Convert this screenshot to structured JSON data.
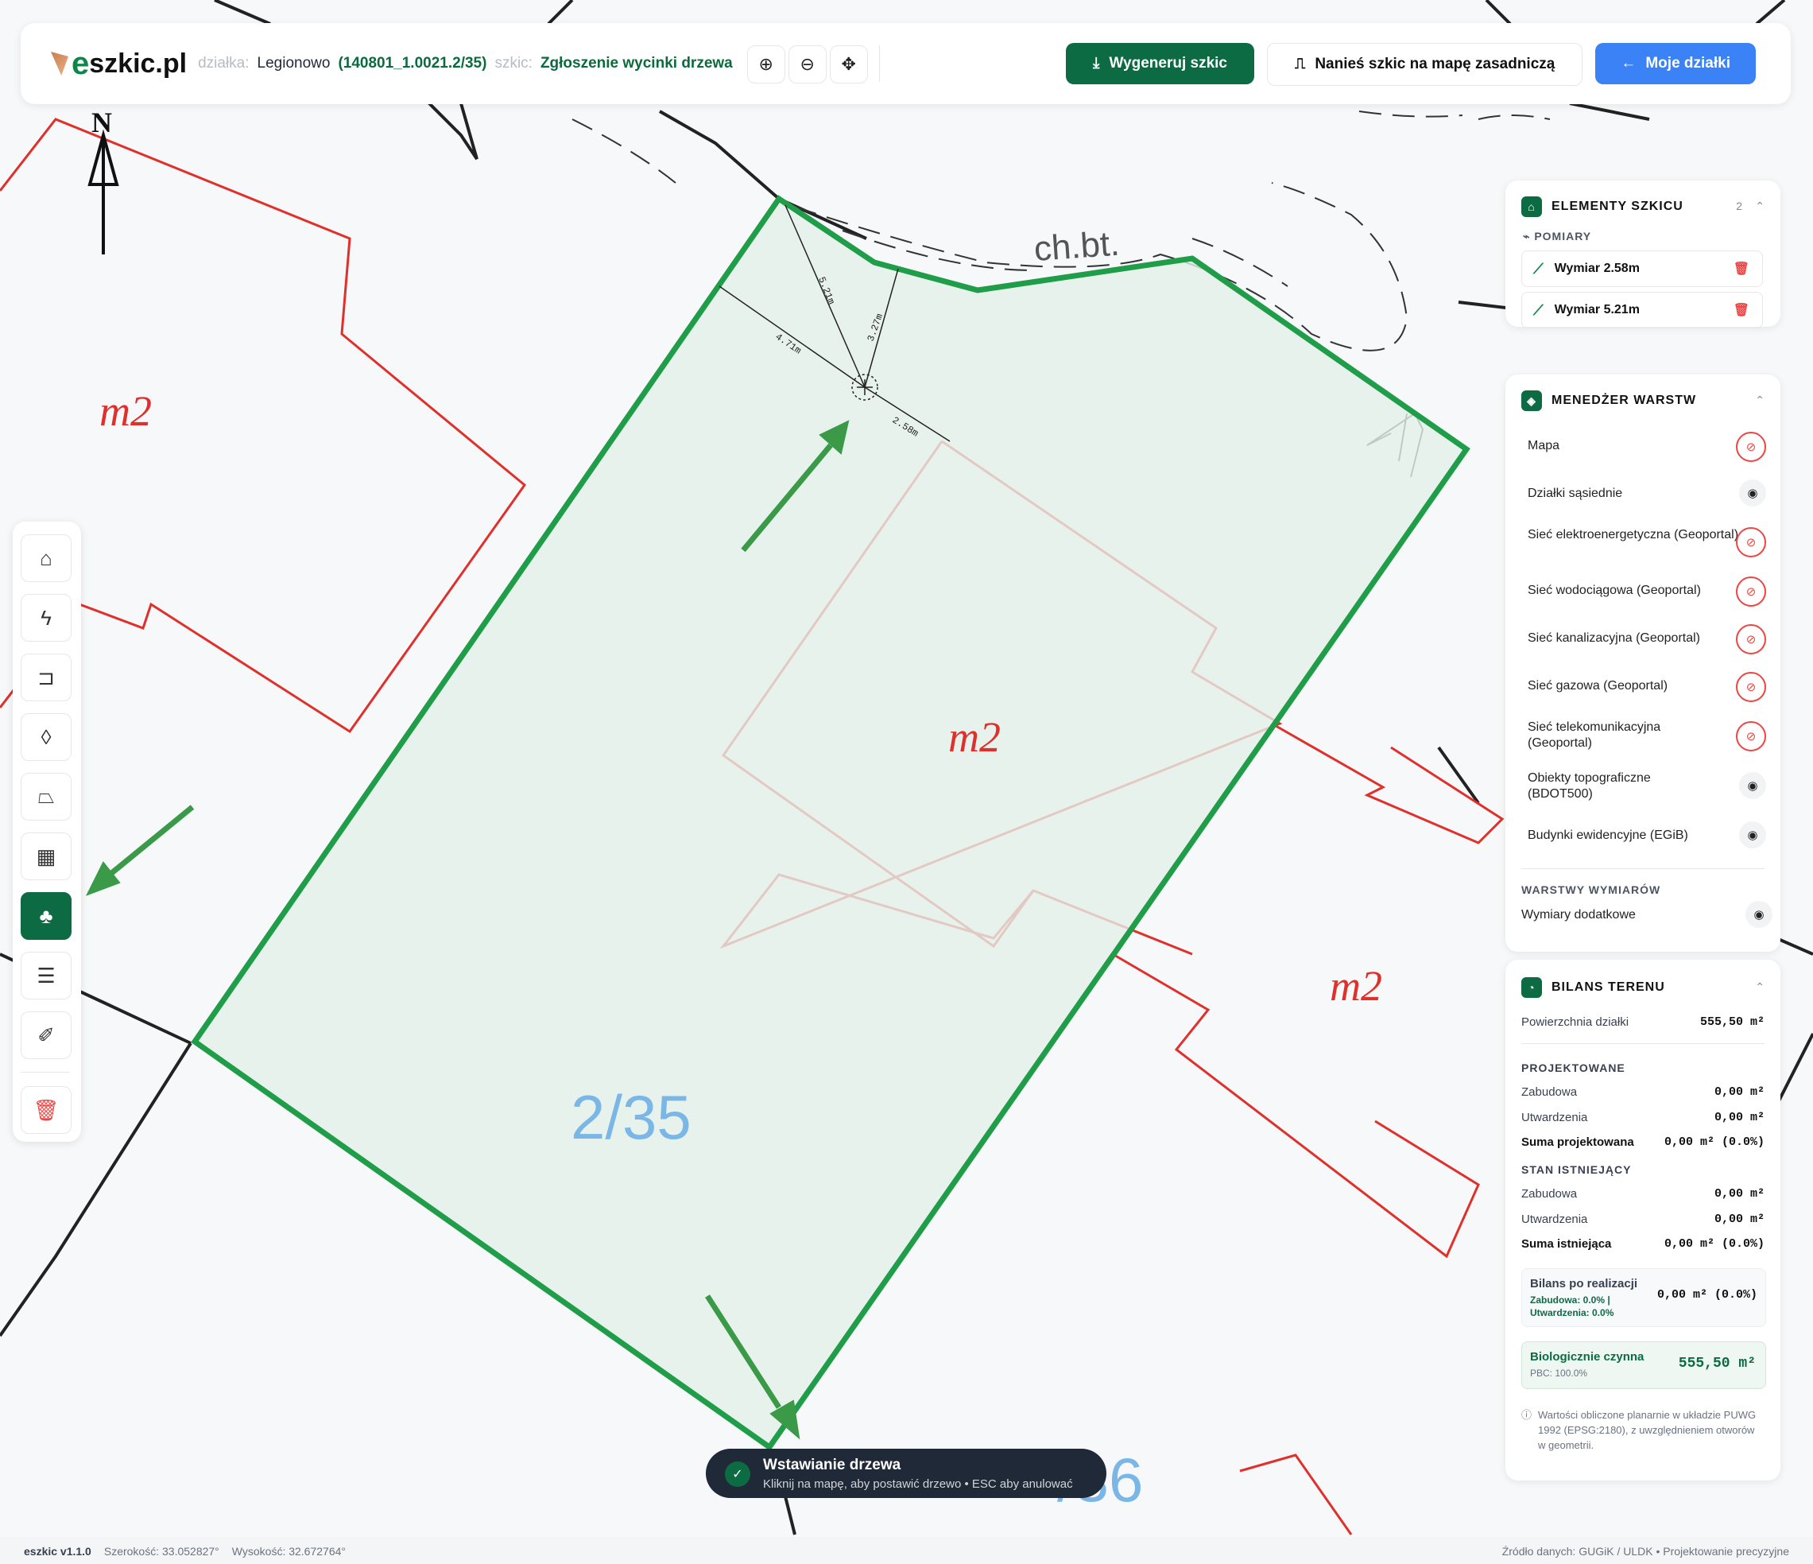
{
  "header": {
    "logo_text": "szkic.pl",
    "logo_letter": "e",
    "plot_label": "działka:",
    "plot_city": "Legionowo",
    "plot_id": "(140801_1.0021.2/35)",
    "sketch_label": "szkic:",
    "sketch_name": "Zgłoszenie wycinki drzewa",
    "buttons": {
      "generate": "Wygeneruj szkic",
      "overlay": "Nanieś szkic na mapę zasadniczą",
      "my_plots": "Moje działki"
    }
  },
  "map": {
    "north": "N",
    "plot_number": "2/35",
    "plot_number_2": "/36",
    "building_labels": [
      "m2",
      "m2",
      "m2"
    ],
    "road_label": "ch.bt.",
    "measurements": [
      "5.21m",
      "4.71m",
      "3.27m",
      "2.58m"
    ]
  },
  "sketch_elements": {
    "title": "ELEMENTY SZKICU",
    "count": "2",
    "section": "POMIARY",
    "items": [
      "Wymiar 2.58m",
      "Wymiar 5.21m"
    ]
  },
  "layers": {
    "title": "MENEDŻER WARSTW",
    "items": [
      {
        "label": "Mapa",
        "visible": false
      },
      {
        "label": "Działki sąsiednie",
        "visible": true
      },
      {
        "label": "Sieć elektroenergetyczna (Geoportal)",
        "visible": false
      },
      {
        "label": "Sieć wodociągowa (Geoportal)",
        "visible": false
      },
      {
        "label": "Sieć kanalizacyjna (Geoportal)",
        "visible": false
      },
      {
        "label": "Sieć gazowa (Geoportal)",
        "visible": false
      },
      {
        "label": "Sieć telekomunikacyjna (Geoportal)",
        "visible": false
      },
      {
        "label": "Obiekty topograficzne (BDOT500)",
        "visible": true
      },
      {
        "label": "Budynki ewidencyjne (EGiB)",
        "visible": true
      }
    ],
    "dim_section": "WARSTWY WYMIARÓW",
    "dim_item": "Wymiary dodatkowe"
  },
  "balance": {
    "title": "BILANS TERENU",
    "area_label": "Powierzchnia działki",
    "area_value": "555,50 m²",
    "projected_title": "PROJEKTOWANE",
    "proj_build_label": "Zabudowa",
    "proj_build_value": "0,00 m²",
    "proj_paved_label": "Utwardzenia",
    "proj_paved_value": "0,00 m²",
    "proj_sum_label": "Suma projektowana",
    "proj_sum_value": "0,00 m² (0.0%)",
    "existing_title": "STAN ISTNIEJĄCY",
    "ex_build_label": "Zabudowa",
    "ex_build_value": "0,00 m²",
    "ex_paved_label": "Utwardzenia",
    "ex_paved_value": "0,00 m²",
    "ex_sum_label": "Suma istniejąca",
    "ex_sum_value": "0,00 m² (0.0%)",
    "after_title": "Bilans po realizacji",
    "after_build": "Zabudowa: 0.0% |",
    "after_paved": "Utwardzenia: 0.0%",
    "after_value": "0,00 m² (0.0%)",
    "bio_title": "Biologicznie czynna",
    "bio_sub": "PBC: 100.0%",
    "bio_value": "555,50 m²",
    "note": "Wartości obliczone planarnie w układzie PUWG 1992 (EPSG:2180), z uwzględnieniem otworów w geometrii."
  },
  "toast": {
    "title": "Wstawianie drzewa",
    "message": "Kliknij na mapę, aby postawić drzewo • ESC aby anulować"
  },
  "status": {
    "version": "eszkic v1.1.0",
    "lat": "Szerokość: 33.052827°",
    "lon": "Wysokość: 32.672764°",
    "source": "Źródło danych: GUGiK / ULDK • Projektowanie precyzyjne"
  },
  "colors": {
    "accent": "#0c6b43",
    "plot_outline": "#1f9d48",
    "building": "#e0302b",
    "blue": "#3b82f6"
  }
}
